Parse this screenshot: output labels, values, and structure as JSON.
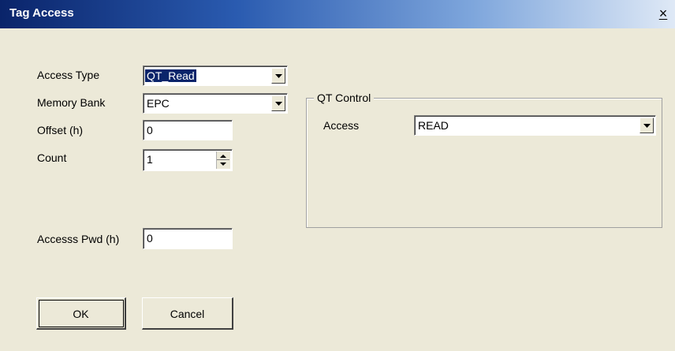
{
  "window": {
    "title": "Tag Access",
    "close_glyph": "×"
  },
  "form": {
    "access_type": {
      "label": "Access Type",
      "value": "QT_Read"
    },
    "memory_bank": {
      "label": "Memory Bank",
      "value": "EPC"
    },
    "offset": {
      "label": "Offset (h)",
      "value": "0"
    },
    "count": {
      "label": "Count",
      "value": "1"
    },
    "access_pwd": {
      "label": "Accesss Pwd (h)",
      "value": "0"
    }
  },
  "qt_control": {
    "title": "QT Control",
    "access": {
      "label": "Access",
      "value": "READ"
    }
  },
  "buttons": {
    "ok": "OK",
    "cancel": "Cancel"
  },
  "colors": {
    "title_bar_start": "#0a246a",
    "selection": "#0a246a",
    "face": "#ece9d8"
  }
}
